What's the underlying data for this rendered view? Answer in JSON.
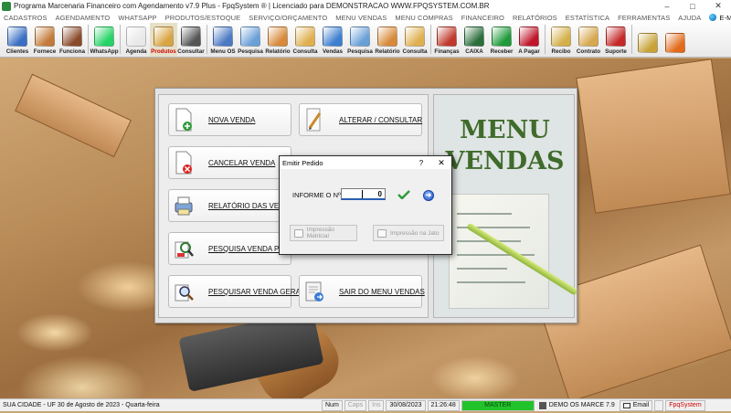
{
  "window": {
    "title": "Programa Marcenaria Financeiro com Agendamento v7.9 Plus - FpqSystem ® | Licenciado para  DEMONSTRACAO WWW.FPQSYSTEM.COM.BR",
    "minimize": "–",
    "maximize": "□",
    "close": "✕"
  },
  "menubar": {
    "items": [
      "CADASTROS",
      "AGENDAMENTO",
      "WHATSAPP",
      "PRODUTOS/ESTOQUE",
      "SERVIÇO/ORÇAMENTO",
      "MENU VENDAS",
      "MENU COMPRAS",
      "FINANCEIRO",
      "RELATÓRIOS",
      "ESTATÍSTICA",
      "FERRAMENTAS",
      "AJUDA"
    ],
    "email": "E-MAIL"
  },
  "toolbar": {
    "buttons": [
      {
        "label": "Clientes",
        "icon": "clients-icon",
        "color": "#3a6fc4"
      },
      {
        "label": "Fornece",
        "icon": "suppliers-icon",
        "color": "#c47a3a"
      },
      {
        "label": "Funciona",
        "icon": "employees-icon",
        "color": "#8a4a2a"
      },
      {
        "label": "WhatsApp",
        "icon": "whatsapp-icon",
        "color": "#25d366"
      },
      {
        "label": "Agenda",
        "icon": "calendar-icon",
        "color": "#e8e8e8"
      },
      {
        "label": "Produtos",
        "icon": "boxes-icon",
        "color": "#d9a441"
      },
      {
        "label": "Consultar",
        "icon": "barcode-icon",
        "color": "#555555"
      },
      {
        "label": "Menu OS",
        "icon": "service-order-icon",
        "color": "#4b79c4"
      },
      {
        "label": "Pesquisa",
        "icon": "search-doc-icon",
        "color": "#6aa0d8"
      },
      {
        "label": "Relatório",
        "icon": "report-icon",
        "color": "#d88a3a"
      },
      {
        "label": "Consulta",
        "icon": "folder-icon",
        "color": "#e0b050"
      },
      {
        "label": "Vendas",
        "icon": "monitor-icon",
        "color": "#3d7fd0"
      },
      {
        "label": "Pesquisa",
        "icon": "search-doc-icon",
        "color": "#6aa0d8"
      },
      {
        "label": "Relatório",
        "icon": "report-icon",
        "color": "#d88a3a"
      },
      {
        "label": "Consulta",
        "icon": "folder-icon",
        "color": "#e0b050"
      },
      {
        "label": "Finanças",
        "icon": "finance-chart-icon",
        "color": "#c0392b"
      },
      {
        "label": "CAIXA",
        "icon": "cash-register-icon",
        "color": "#2a6e3a"
      },
      {
        "label": "Receber",
        "icon": "receive-money-icon",
        "color": "#1f9a3a"
      },
      {
        "label": "A Pagar",
        "icon": "pay-money-icon",
        "color": "#c0162a"
      },
      {
        "label": "Recibo",
        "icon": "receipt-icon",
        "color": "#d4b04a"
      },
      {
        "label": "Contrato",
        "icon": "contract-icon",
        "color": "#d8a850"
      },
      {
        "label": "Suporte",
        "icon": "support-icon",
        "color": "#c62828"
      },
      {
        "label": "",
        "icon": "coins-icon",
        "color": "#c9a33a"
      },
      {
        "label": "",
        "icon": "exit-icon",
        "color": "#e26a1a"
      }
    ]
  },
  "menu_panel": {
    "title_line1": "MENU",
    "title_line2": "VENDAS",
    "buttons": [
      {
        "label": "NOVA VENDA",
        "icon": "new-document-icon"
      },
      {
        "label": "ALTERAR / CONSULTAR",
        "icon": "edit-pencil-icon"
      },
      {
        "label": "CANCELAR VENDA",
        "icon": "cancel-document-icon"
      },
      {
        "label": "RELATÓRIO DAS VENDAS",
        "icon": "printer-icon"
      },
      {
        "label": "PESQUISA VENDA PENDENTE",
        "icon": "pending-search-icon"
      },
      {
        "label": "PESQUISAR VENDA GERAL",
        "icon": "general-search-icon"
      },
      {
        "label": "SAIR DO MENU VENDAS",
        "icon": "exit-door-icon"
      }
    ]
  },
  "dialog": {
    "title": "Emitir Pedido",
    "help": "?",
    "close": "✕",
    "label": "INFORME O Nº",
    "input_value": "0",
    "print_matrix": "Impressão Matricial",
    "print_inkjet": "Impressão na Jato"
  },
  "statusbar": {
    "city": "SUA CIDADE - UF 30 de Agosto de 2023 - Quarta-feira",
    "num": "Num",
    "caps": "Caps",
    "ins": "Ins",
    "date": "30/08/2023",
    "time": "21:26:48",
    "user": "MASTER",
    "version": "DEMO OS MARCE 7.9",
    "email": "Email",
    "brand": "FpqSystem"
  }
}
